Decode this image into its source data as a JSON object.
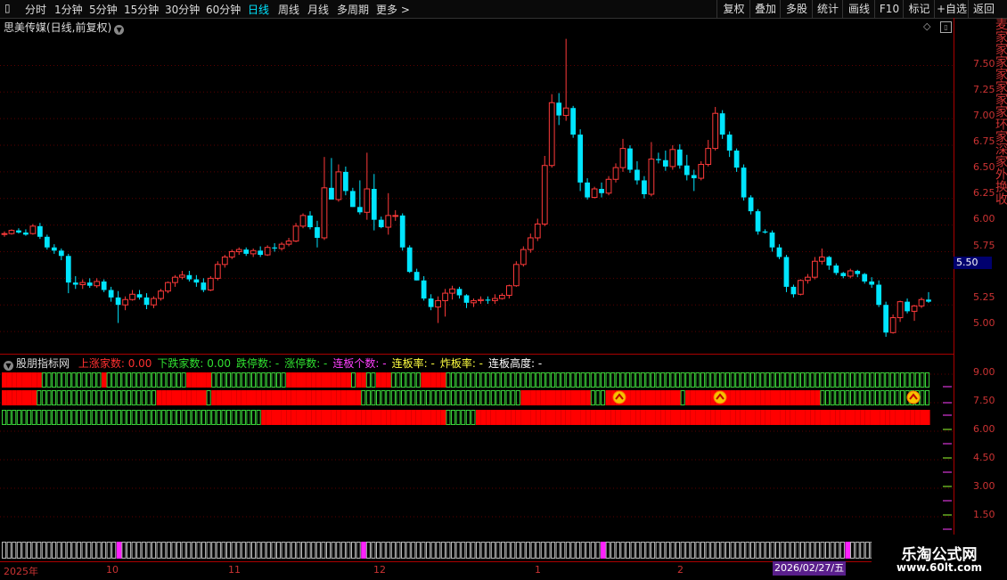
{
  "toolbar": {
    "periods": [
      "分时",
      "1分钟",
      "5分钟",
      "15分钟",
      "30分钟",
      "60分钟",
      "日线",
      "周线",
      "月线",
      "多周期",
      "更多"
    ],
    "active_period": "日线",
    "right_buttons": [
      "复权",
      "叠加",
      "多股",
      "统计",
      "画线",
      "F10",
      "标记",
      "+自选",
      "返回"
    ]
  },
  "stock": {
    "title": "思美传媒(日线,前复权)"
  },
  "price_axis": {
    "labels": [
      "7.50",
      "7.25",
      "7.00",
      "6.75",
      "6.50",
      "6.25",
      "6.00",
      "5.75",
      "5.50",
      "5.25",
      "5.00"
    ],
    "current_price": "5.50"
  },
  "indicator": {
    "name": "股朋指标网",
    "fields": [
      {
        "text": "上涨家数: 0.00",
        "color": "#ff3030"
      },
      {
        "text": "下跌家数: 0.00",
        "color": "#30e030"
      },
      {
        "text": "跌停数: -",
        "color": "#30e030"
      },
      {
        "text": "涨停数: -",
        "color": "#30e030"
      },
      {
        "text": "连板个数: -",
        "color": "#ff40ff"
      },
      {
        "text": "连板率: -",
        "color": "#ffff40"
      },
      {
        "text": "炸板率: -",
        "color": "#ffff40"
      },
      {
        "text": "连板高度: -",
        "color": "#ffffff"
      }
    ],
    "axis_labels": [
      "9.00",
      "7.50",
      "6.00",
      "4.50",
      "3.00",
      "1.50"
    ]
  },
  "date_axis": {
    "labels": [
      "2025年",
      "10",
      "11",
      "12",
      "1",
      "2"
    ],
    "cursor_date": "2026/02/27/五"
  },
  "watermark": {
    "title": "乐淘公式网",
    "url": "www.60lt.com"
  },
  "right_strip_text": "麦家家家家家家家环家深家外换收",
  "colors": {
    "up": "#ff3a3a",
    "down": "#00e5ff",
    "grid": "#5a0000",
    "green_box": "#3ad33a",
    "red_box": "#ff0000"
  },
  "chart_data": {
    "type": "candlestick",
    "ylim": [
      4.85,
      7.78
    ],
    "candles": [
      [
        5.92,
        5.94,
        5.89,
        5.92
      ],
      [
        5.92,
        5.96,
        5.91,
        5.95
      ],
      [
        5.95,
        5.97,
        5.92,
        5.93
      ],
      [
        5.93,
        5.96,
        5.9,
        5.91
      ],
      [
        5.92,
        6.01,
        5.91,
        5.99
      ],
      [
        5.99,
        6.02,
        5.87,
        5.89
      ],
      [
        5.89,
        5.91,
        5.77,
        5.79
      ],
      [
        5.79,
        5.82,
        5.73,
        5.76
      ],
      [
        5.76,
        5.78,
        5.67,
        5.71
      ],
      [
        5.71,
        5.73,
        5.36,
        5.46
      ],
      [
        5.46,
        5.52,
        5.4,
        5.44
      ],
      [
        5.44,
        5.49,
        5.4,
        5.46
      ],
      [
        5.46,
        5.5,
        5.41,
        5.43
      ],
      [
        5.43,
        5.5,
        5.41,
        5.47
      ],
      [
        5.47,
        5.49,
        5.37,
        5.39
      ],
      [
        5.39,
        5.42,
        5.28,
        5.32
      ],
      [
        5.32,
        5.38,
        5.08,
        5.25
      ],
      [
        5.25,
        5.33,
        5.2,
        5.3
      ],
      [
        5.3,
        5.39,
        5.29,
        5.35
      ],
      [
        5.35,
        5.39,
        5.3,
        5.32
      ],
      [
        5.32,
        5.36,
        5.21,
        5.25
      ],
      [
        5.25,
        5.33,
        5.22,
        5.31
      ],
      [
        5.31,
        5.4,
        5.29,
        5.38
      ],
      [
        5.38,
        5.47,
        5.36,
        5.46
      ],
      [
        5.46,
        5.53,
        5.42,
        5.51
      ],
      [
        5.51,
        5.57,
        5.49,
        5.53
      ],
      [
        5.53,
        5.57,
        5.47,
        5.49
      ],
      [
        5.49,
        5.53,
        5.42,
        5.46
      ],
      [
        5.46,
        5.5,
        5.37,
        5.39
      ],
      [
        5.39,
        5.52,
        5.38,
        5.5
      ],
      [
        5.5,
        5.66,
        5.48,
        5.63
      ],
      [
        5.63,
        5.72,
        5.6,
        5.7
      ],
      [
        5.7,
        5.77,
        5.68,
        5.75
      ],
      [
        5.75,
        5.79,
        5.72,
        5.77
      ],
      [
        5.77,
        5.79,
        5.71,
        5.73
      ],
      [
        5.73,
        5.78,
        5.7,
        5.76
      ],
      [
        5.76,
        5.8,
        5.7,
        5.72
      ],
      [
        5.72,
        5.81,
        5.71,
        5.79
      ],
      [
        5.79,
        5.83,
        5.75,
        5.78
      ],
      [
        5.78,
        5.84,
        5.76,
        5.82
      ],
      [
        5.82,
        5.88,
        5.8,
        5.85
      ],
      [
        5.85,
        6.02,
        5.84,
        5.99
      ],
      [
        5.99,
        6.11,
        5.97,
        6.09
      ],
      [
        6.09,
        6.13,
        5.96,
        5.98
      ],
      [
        5.98,
        6.04,
        5.79,
        5.88
      ],
      [
        5.88,
        6.64,
        5.86,
        6.35
      ],
      [
        6.35,
        6.63,
        6.29,
        6.24
      ],
      [
        6.24,
        6.57,
        6.22,
        6.5
      ],
      [
        6.5,
        6.55,
        6.28,
        6.32
      ],
      [
        6.32,
        6.35,
        6.17,
        6.17
      ],
      [
        6.17,
        6.42,
        6.1,
        6.12
      ],
      [
        6.12,
        6.68,
        6.05,
        6.34
      ],
      [
        6.34,
        6.48,
        5.95,
        6.05
      ],
      [
        6.05,
        6.08,
        5.97,
        5.98
      ],
      [
        5.98,
        6.3,
        5.91,
        6.09
      ],
      [
        6.09,
        6.14,
        6.04,
        6.09
      ],
      [
        6.09,
        6.11,
        5.76,
        5.79
      ],
      [
        5.79,
        5.81,
        5.55,
        5.56
      ],
      [
        5.56,
        5.59,
        5.48,
        5.48
      ],
      [
        5.48,
        5.52,
        5.29,
        5.31
      ],
      [
        5.31,
        5.35,
        5.2,
        5.23
      ],
      [
        5.23,
        5.33,
        5.08,
        5.29
      ],
      [
        5.29,
        5.4,
        5.14,
        5.36
      ],
      [
        5.36,
        5.43,
        5.3,
        5.4
      ],
      [
        5.4,
        5.42,
        5.31,
        5.34
      ],
      [
        5.34,
        5.35,
        5.22,
        5.27
      ],
      [
        5.27,
        5.31,
        5.23,
        5.29
      ],
      [
        5.29,
        5.33,
        5.26,
        5.3
      ],
      [
        5.3,
        5.33,
        5.26,
        5.29
      ],
      [
        5.29,
        5.35,
        5.26,
        5.31
      ],
      [
        5.31,
        5.36,
        5.3,
        5.34
      ],
      [
        5.34,
        5.44,
        5.31,
        5.43
      ],
      [
        5.43,
        5.66,
        5.42,
        5.63
      ],
      [
        5.63,
        5.8,
        5.61,
        5.77
      ],
      [
        5.77,
        5.92,
        5.74,
        5.88
      ],
      [
        5.88,
        6.06,
        5.85,
        6.01
      ],
      [
        6.01,
        6.65,
        5.99,
        6.56
      ],
      [
        6.56,
        7.23,
        6.54,
        7.15
      ],
      [
        7.15,
        7.24,
        6.94,
        7.03
      ],
      [
        7.03,
        7.75,
        6.98,
        7.1
      ],
      [
        7.1,
        7.12,
        6.82,
        6.85
      ],
      [
        6.85,
        6.9,
        6.32,
        6.4
      ],
      [
        6.4,
        6.44,
        6.24,
        6.26
      ],
      [
        6.26,
        6.36,
        6.25,
        6.34
      ],
      [
        6.34,
        6.4,
        6.26,
        6.3
      ],
      [
        6.3,
        6.46,
        6.28,
        6.43
      ],
      [
        6.43,
        6.58,
        6.4,
        6.54
      ],
      [
        6.54,
        6.81,
        6.5,
        6.72
      ],
      [
        6.72,
        6.75,
        6.49,
        6.52
      ],
      [
        6.52,
        6.6,
        6.38,
        6.42
      ],
      [
        6.42,
        6.46,
        6.25,
        6.29
      ],
      [
        6.29,
        6.78,
        6.27,
        6.62
      ],
      [
        6.62,
        6.68,
        6.58,
        6.61
      ],
      [
        6.61,
        6.7,
        6.51,
        6.55
      ],
      [
        6.55,
        6.75,
        6.52,
        6.71
      ],
      [
        6.71,
        6.76,
        6.53,
        6.56
      ],
      [
        6.56,
        6.66,
        6.42,
        6.47
      ],
      [
        6.47,
        6.52,
        6.32,
        6.44
      ],
      [
        6.44,
        6.6,
        6.42,
        6.57
      ],
      [
        6.57,
        6.8,
        6.55,
        6.72
      ],
      [
        6.72,
        7.11,
        6.7,
        7.05
      ],
      [
        7.05,
        7.08,
        6.81,
        6.85
      ],
      [
        6.85,
        6.88,
        6.64,
        6.7
      ],
      [
        6.7,
        6.72,
        6.5,
        6.54
      ],
      [
        6.54,
        6.57,
        6.23,
        6.26
      ],
      [
        6.26,
        6.28,
        6.1,
        6.13
      ],
      [
        6.13,
        6.15,
        5.91,
        5.94
      ],
      [
        5.94,
        5.96,
        5.92,
        5.93
      ],
      [
        5.93,
        5.95,
        5.75,
        5.79
      ],
      [
        5.79,
        5.82,
        5.68,
        5.7
      ],
      [
        5.7,
        5.72,
        5.37,
        5.42
      ],
      [
        5.42,
        5.44,
        5.32,
        5.35
      ],
      [
        5.35,
        5.49,
        5.34,
        5.48
      ],
      [
        5.48,
        5.54,
        5.45,
        5.51
      ],
      [
        5.51,
        5.7,
        5.49,
        5.66
      ],
      [
        5.66,
        5.78,
        5.63,
        5.7
      ],
      [
        5.7,
        5.71,
        5.58,
        5.62
      ],
      [
        5.62,
        5.64,
        5.53,
        5.55
      ],
      [
        5.55,
        5.56,
        5.5,
        5.52
      ],
      [
        5.52,
        5.59,
        5.5,
        5.57
      ],
      [
        5.57,
        5.58,
        5.51,
        5.54
      ],
      [
        5.54,
        5.55,
        5.45,
        5.47
      ],
      [
        5.47,
        5.51,
        5.41,
        5.44
      ],
      [
        5.44,
        5.48,
        5.23,
        5.25
      ],
      [
        5.25,
        5.28,
        4.95,
        4.99
      ],
      [
        4.99,
        5.16,
        4.98,
        5.13
      ],
      [
        5.13,
        5.29,
        5.09,
        5.28
      ],
      [
        5.28,
        5.31,
        5.17,
        5.19
      ],
      [
        5.19,
        5.25,
        5.1,
        5.24
      ],
      [
        5.24,
        5.32,
        5.22,
        5.3
      ],
      [
        5.3,
        5.37,
        5.27,
        5.28
      ]
    ]
  }
}
